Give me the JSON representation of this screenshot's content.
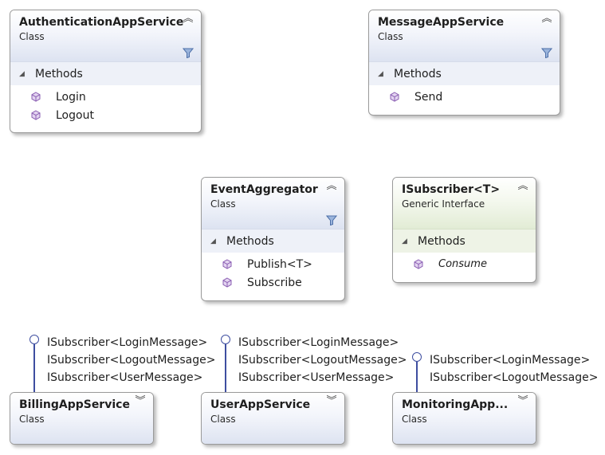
{
  "shapes": {
    "authentication": {
      "name": "AuthenticationAppService",
      "stereotype": "Class",
      "section": "Methods",
      "members": [
        "Login",
        "Logout"
      ]
    },
    "message": {
      "name": "MessageAppService",
      "stereotype": "Class",
      "section": "Methods",
      "members": [
        "Send"
      ]
    },
    "event": {
      "name": "EventAggregator",
      "stereotype": "Class",
      "section": "Methods",
      "members": [
        "Publish<T>",
        "Subscribe"
      ]
    },
    "isubscriber": {
      "name": "ISubscriber<T>",
      "stereotype": "Generic Interface",
      "section": "Methods",
      "members": [
        "Consume"
      ]
    },
    "billing": {
      "name": "BillingAppService",
      "stereotype": "Class",
      "interfaces": [
        "ISubscriber<LoginMessage>",
        "ISubscriber<LogoutMessage>",
        "ISubscriber<UserMessage>"
      ]
    },
    "user": {
      "name": "UserAppService",
      "stereotype": "Class",
      "interfaces": [
        "ISubscriber<LoginMessage>",
        "ISubscriber<LogoutMessage>",
        "ISubscriber<UserMessage>"
      ]
    },
    "monitoring": {
      "name": "MonitoringApp...",
      "stereotype": "Class",
      "interfaces": [
        "ISubscriber<LoginMessage>",
        "ISubscriber<LogoutMessage>"
      ]
    }
  },
  "icons": {
    "collapse": "double-chevron-up-icon",
    "expand": "double-chevron-down-icon",
    "filter": "filter-icon",
    "section_toggle": "triangle-collapse-icon",
    "method": "method-cube-icon",
    "lollipop": "interface-lollipop-icon"
  },
  "colors": {
    "class_header": "#dde3f1",
    "interface_header": "#e2ecd5",
    "lollipop": "#3e4ea0",
    "method_icon": "#8b5fb3"
  }
}
